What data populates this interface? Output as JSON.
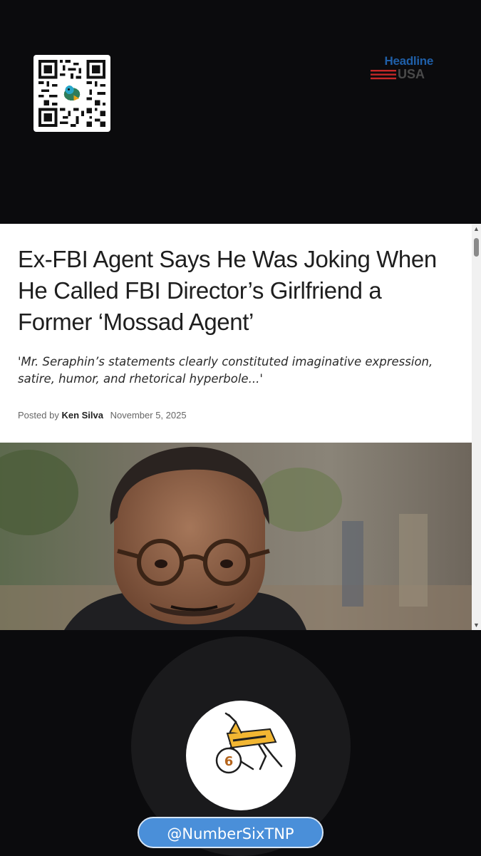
{
  "qr": {
    "icon": "qr-code-icon"
  },
  "brand": {
    "line1": "Headline",
    "line2": "USA",
    "colors": {
      "blue": "#1f5fa8",
      "red": "#c62828",
      "gray": "#4a4a4a"
    }
  },
  "article": {
    "headline": "Ex-FBI Agent Says He Was Joking When He Called FBI Director’s Girlfriend a Former ‘Mossad Agent’",
    "subheadline": "'Mr. Seraphin’s statements clearly constituted imaginative expression, satire, humor, and rhetorical hyperbole...'",
    "byline_prefix": "Posted by",
    "author": "Ken Silva",
    "date": "November 5, 2025"
  },
  "scrollbar": {
    "up_icon": "triangle-up-icon",
    "down_icon": "triangle-down-icon"
  },
  "channel": {
    "badge_number": "6",
    "handle": "@NumberSixTNP",
    "accent": "#4a8fd9"
  }
}
